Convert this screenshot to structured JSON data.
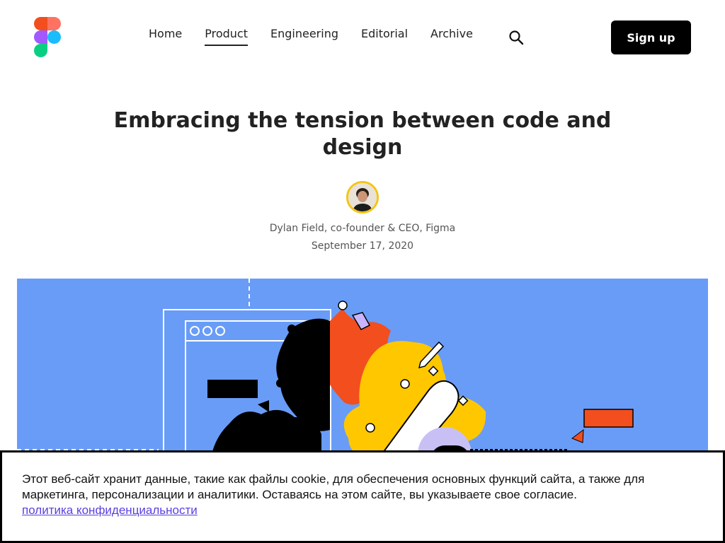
{
  "header": {
    "nav": [
      {
        "label": "Home",
        "active": false
      },
      {
        "label": "Product",
        "active": true
      },
      {
        "label": "Engineering",
        "active": false
      },
      {
        "label": "Editorial",
        "active": false
      },
      {
        "label": "Archive",
        "active": false
      }
    ],
    "search_icon": "search-icon",
    "signup_label": "Sign up"
  },
  "article": {
    "title": "Embracing the tension between code and design",
    "author": "Dylan Field, co-founder & CEO, Figma",
    "date": "September 17, 2020"
  },
  "cookie_banner": {
    "text": "Этот веб-сайт хранит данные, такие как файлы cookie, для обеспечения основных функций сайта, а также для маркетинга, персонализации и аналитики. Оставаясь на этом сайте, вы указываете свое согласие.",
    "link": "политика конфиденциальности"
  },
  "colors": {
    "hero_bg": "#699cf7",
    "orange": "#f24e1e",
    "yellow": "#ffc700",
    "purple": "#a259ff",
    "accent_link": "#5a3fe0"
  }
}
